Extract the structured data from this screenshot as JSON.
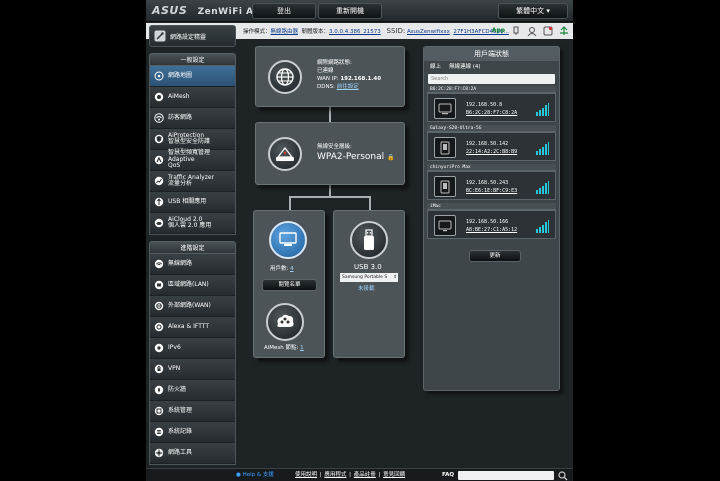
{
  "header": {
    "brand": "ASUS",
    "model": "ZenWiFi AC",
    "logout_label": "登出",
    "reboot_label": "重新開機",
    "language_label": "繁體中文"
  },
  "infobar": {
    "mode_label": "操作模式：",
    "mode_value": "無線路由器",
    "firmware_label": "韌體版本：",
    "firmware_value": "3.0.0.4.386_21573",
    "ssid_label": "SSID:",
    "ssid_value_1": "AsusZenwifixxx",
    "ssid_value_2": "27F1H3AFCD4E10...",
    "app_label": "App"
  },
  "sidebar": {
    "qis_label": "網路設定精靈",
    "general_header": "一般設定",
    "general_items": [
      {
        "label": "網路地圖",
        "icon": "network-map-icon"
      },
      {
        "label": "AiMesh",
        "icon": "aimesh-icon"
      },
      {
        "label": "訪客網路",
        "icon": "guest-network-icon"
      },
      {
        "label": "AiProtection",
        "label2": "智慧型安全防護",
        "icon": "aiprotection-icon"
      },
      {
        "label": "智慧型頻寬管理 Adaptive",
        "label2": "QoS",
        "icon": "qos-icon"
      },
      {
        "label": "Traffic Analyzer",
        "label2": "流量分析",
        "icon": "traffic-analyzer-icon"
      },
      {
        "label": "USB 相關應用",
        "icon": "usb-icon"
      },
      {
        "label": "AiCloud 2.0",
        "label2": "個人雲 2.0 應用",
        "icon": "aicloud-icon"
      }
    ],
    "advanced_header": "進階設定",
    "advanced_items": [
      {
        "label": "無線網路",
        "icon": "wireless-icon"
      },
      {
        "label": "區域網路(LAN)",
        "icon": "lan-icon"
      },
      {
        "label": "外部網路(WAN)",
        "icon": "wan-icon"
      },
      {
        "label": "Alexa & IFTTT",
        "icon": "alexa-icon"
      },
      {
        "label": "IPv6",
        "icon": "ipv6-icon"
      },
      {
        "label": "VPN",
        "icon": "vpn-icon"
      },
      {
        "label": "防火牆",
        "icon": "firewall-icon"
      },
      {
        "label": "系統管理",
        "icon": "administration-icon"
      },
      {
        "label": "系統記錄",
        "icon": "system-log-icon"
      },
      {
        "label": "網路工具",
        "icon": "network-tools-icon"
      }
    ]
  },
  "map": {
    "internet": {
      "status_label": "網際網路狀態:",
      "status_value": "已連線",
      "wan_ip_label": "WAN IP:",
      "wan_ip_value": "192.168.1.40",
      "ddns_label": "DDNS:",
      "ddns_value": "前往設定"
    },
    "router": {
      "security_label": "無線安全層級:",
      "security_value": "WPA2-Personal"
    },
    "clients": {
      "count_label": "用戶數:",
      "count_value": "4",
      "view_list_label": "閱覽名單",
      "aimesh_label": "AiMesh 節點:",
      "aimesh_value": "1"
    },
    "usb": {
      "title": "USB 3.0",
      "device": "Samsung Portable S",
      "link": "未掛載"
    }
  },
  "client_status": {
    "title": "用戶端狀態",
    "tab_online": "線上",
    "tab_wireless": "無線連線 (4)",
    "search_placeholder": "Search",
    "refresh_label": "更新",
    "clients": [
      {
        "name": "B6:2C:28:F7:C8:2A",
        "ip": "192.168.50.8",
        "mac": "B6:2C:28:F7:C8:2A",
        "icon": "device-generic-icon"
      },
      {
        "name": "Galaxy-S20-Ultra-5G",
        "ip": "192.168.50.142",
        "mac": "22:14:A2:2C:B8:B9",
        "icon": "phone-icon"
      },
      {
        "name": "chinyuriPro Max",
        "ip": "192.168.50.243",
        "mac": "BC:E6:1E:BF:C9:E3",
        "icon": "phone-icon"
      },
      {
        "name": "iMac",
        "ip": "192.168.50.166",
        "mac": "A8:BE:27:C1:A5:12",
        "icon": "monitor-icon"
      }
    ]
  },
  "footer": {
    "help_label": "Help & 支援",
    "link_manual": "使用說明",
    "link_app": "應用程式",
    "link_register": "產品註冊",
    "link_feedback": "意見回饋",
    "faq_label": "FAQ"
  },
  "colors": {
    "accent": "#3f6f97",
    "link": "#9fd4ff",
    "signal": "#25c7d9"
  }
}
